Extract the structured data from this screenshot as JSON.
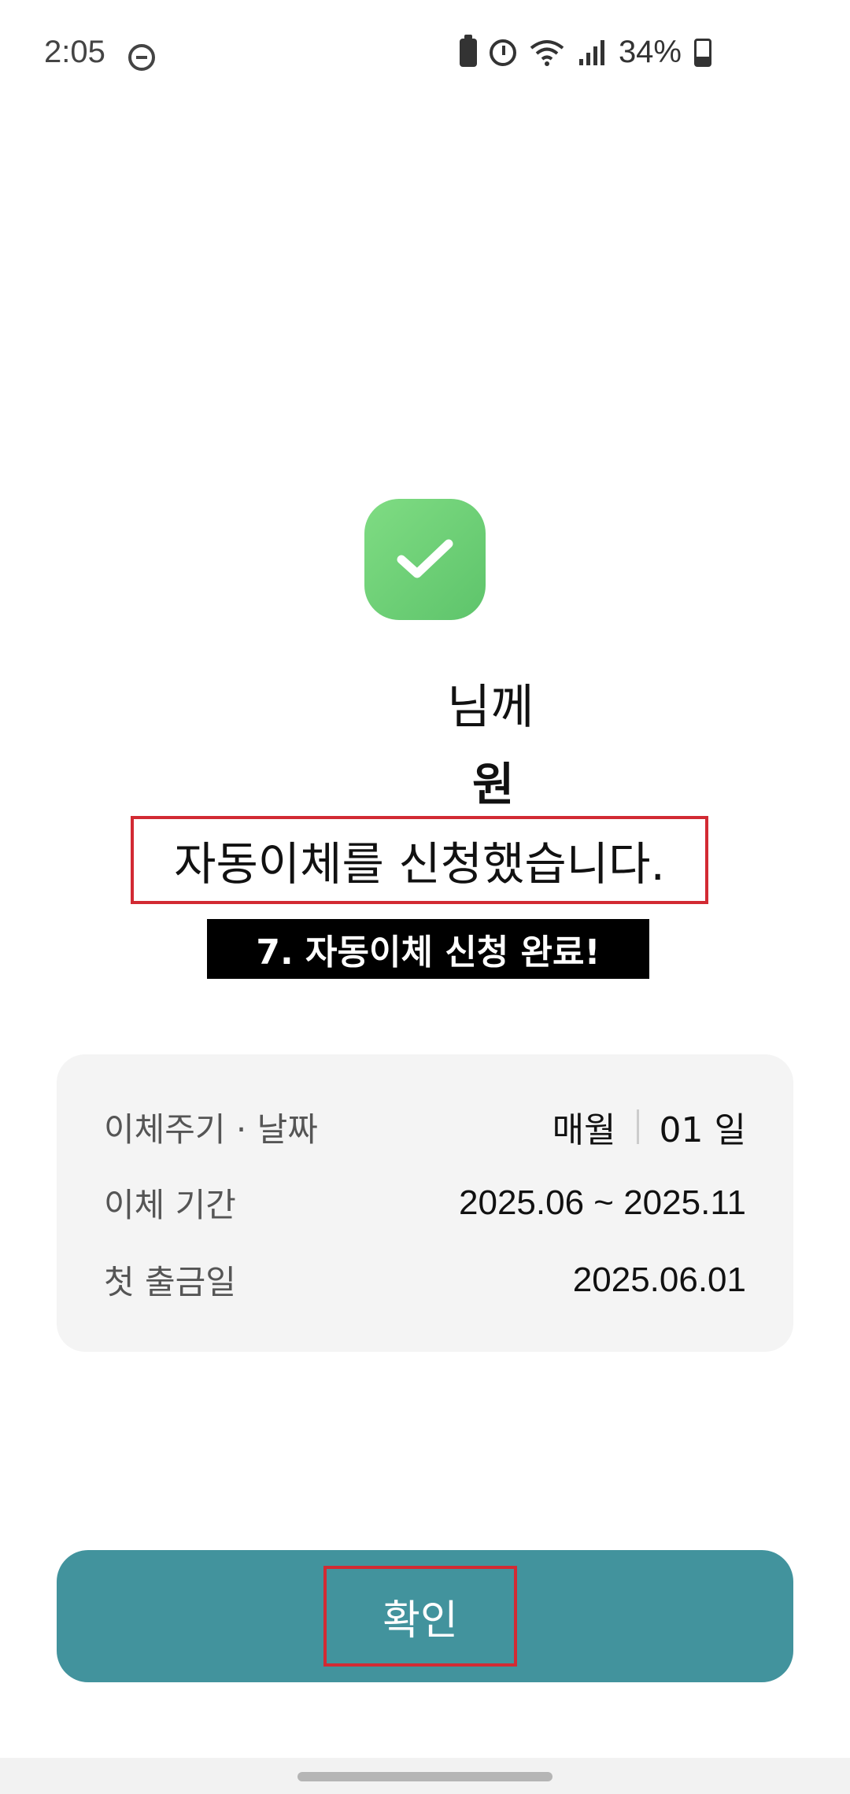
{
  "status_bar": {
    "time": "2:05",
    "battery_percent": "34%",
    "icons": [
      "do-not-disturb-icon",
      "battery-saver-icon",
      "alarm-icon",
      "wifi-icon",
      "signal-icon",
      "battery-icon"
    ]
  },
  "result": {
    "name_line": "님께",
    "amount_line": "원",
    "complete_line": "자동이체를 신청했습니다.",
    "banner": "7. 자동이체 신청 완료!",
    "success_color": "#6cd073"
  },
  "details": {
    "cycle_label": "이체주기 · 날짜",
    "cycle_value": "매월",
    "day_value": "01 일",
    "period_label": "이체 기간",
    "period_value": "2025.06 ~ 2025.11",
    "first_label": "첫 출금일",
    "first_value": "2025.06.01"
  },
  "actions": {
    "confirm_label": "확인",
    "confirm_color": "#42939d",
    "highlight_color": "#d22a33"
  }
}
